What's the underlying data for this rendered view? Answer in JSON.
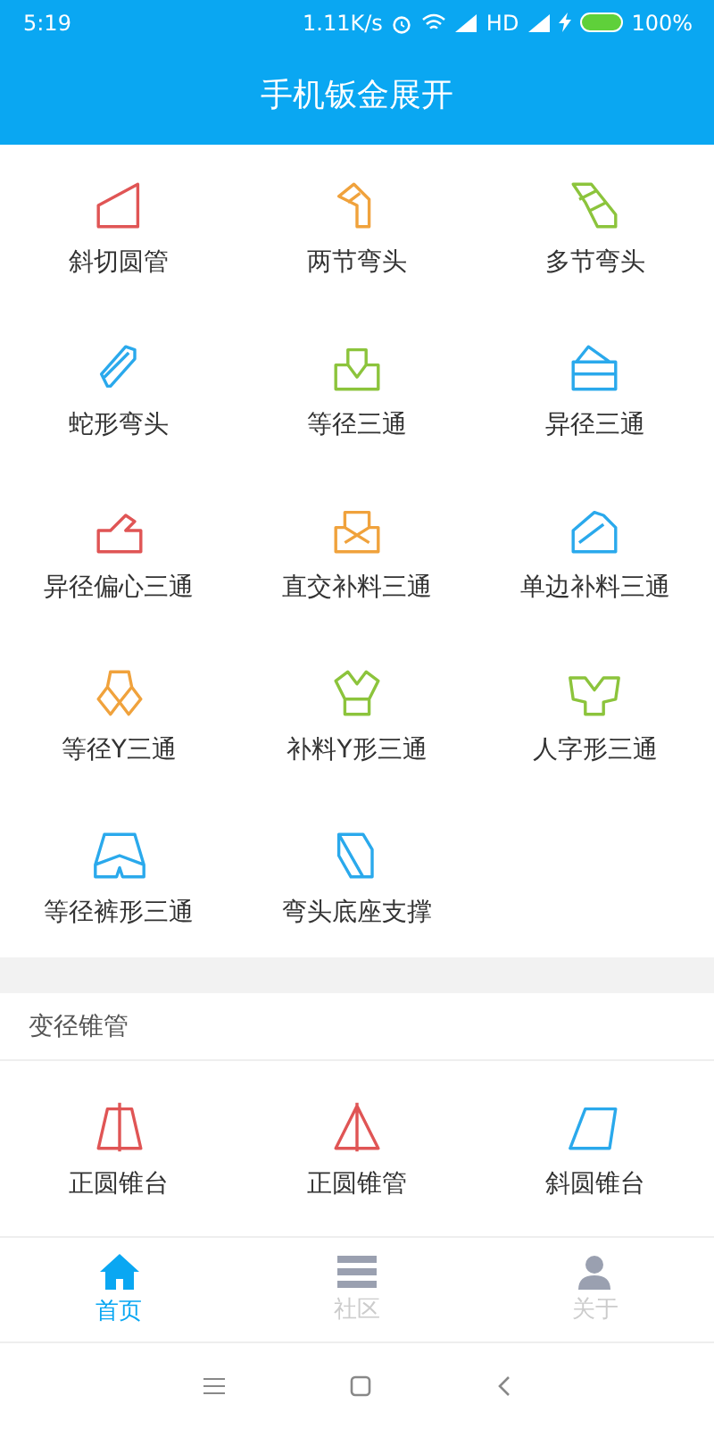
{
  "status_bar": {
    "time": "5:19",
    "speed": "1.11K/s",
    "network": "HD",
    "battery": "100%"
  },
  "header": {
    "title": "手机钣金展开"
  },
  "sections": [
    {
      "items": [
        {
          "label": "斜切圆管",
          "kind": "cut-pipe",
          "color": "#e05555"
        },
        {
          "label": "两节弯头",
          "kind": "two-elbow",
          "color": "#f0a23c"
        },
        {
          "label": "多节弯头",
          "kind": "multi-elbow",
          "color": "#8cc43c"
        },
        {
          "label": "蛇形弯头",
          "kind": "snake",
          "color": "#2aa9ec"
        },
        {
          "label": "等径三通",
          "kind": "tee",
          "color": "#8cc43c"
        },
        {
          "label": "异径三通",
          "kind": "reducing-tee",
          "color": "#2aa9ec"
        },
        {
          "label": "异径偏心三通",
          "kind": "eccentric-tee",
          "color": "#e05555"
        },
        {
          "label": "直交补料三通",
          "kind": "ortho-tee",
          "color": "#f0a23c"
        },
        {
          "label": "单边补料三通",
          "kind": "side-tee",
          "color": "#2aa9ec"
        },
        {
          "label": "等径Y三通",
          "kind": "y-tee",
          "color": "#f0a23c"
        },
        {
          "label": "补料Y形三通",
          "kind": "y-patch",
          "color": "#8cc43c"
        },
        {
          "label": "人字形三通",
          "kind": "herringbone",
          "color": "#8cc43c"
        },
        {
          "label": "等径裤形三通",
          "kind": "pants",
          "color": "#2aa9ec"
        },
        {
          "label": "弯头底座支撑",
          "kind": "support",
          "color": "#2aa9ec"
        }
      ]
    },
    {
      "title": "变径锥管",
      "items": [
        {
          "label": "正圆锥台",
          "kind": "frustum",
          "color": "#e05555"
        },
        {
          "label": "正圆锥管",
          "kind": "cone",
          "color": "#e05555"
        },
        {
          "label": "斜圆锥台",
          "kind": "oblique",
          "color": "#2aa9ec"
        }
      ]
    }
  ],
  "tabs": [
    {
      "label": "首页",
      "kind": "home",
      "selected": true
    },
    {
      "label": "社区",
      "kind": "list",
      "selected": false
    },
    {
      "label": "关于",
      "kind": "person",
      "selected": false
    }
  ]
}
